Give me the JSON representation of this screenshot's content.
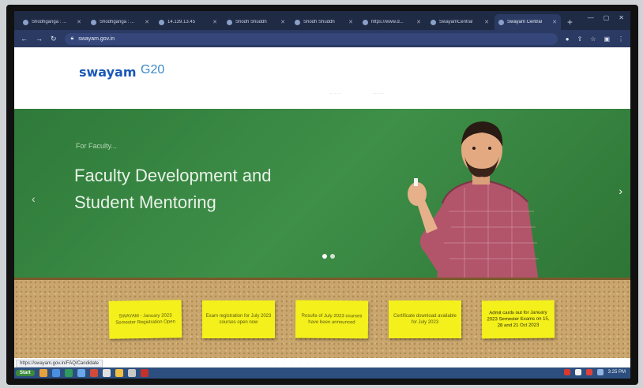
{
  "browser": {
    "tabs": [
      {
        "title": "Shodhganga : ...",
        "active": false
      },
      {
        "title": "Shodhganga : ...",
        "active": false
      },
      {
        "title": "14.139.13.45",
        "active": false
      },
      {
        "title": "Shodh Shuddh",
        "active": false
      },
      {
        "title": "Shodh Shuddh",
        "active": false
      },
      {
        "title": "https://www.d...",
        "active": false
      },
      {
        "title": "SwayamCentral",
        "active": false
      },
      {
        "title": "Swayam Central",
        "active": true
      }
    ],
    "new_tab_label": "+",
    "url": "swayam.gov.in"
  },
  "site": {
    "logo_text": "swayam",
    "g20_text": "G20",
    "nav_items": [
      "· · · · ·",
      "· · · · ·"
    ]
  },
  "hero": {
    "kicker": "For Faculty...",
    "title_line1": "Faculty Development and",
    "title_line2": "Student Mentoring",
    "prev_label": "‹",
    "next_label": "›"
  },
  "notes": [
    {
      "text": "SWAYAM - January 2023 Semester Registration Open"
    },
    {
      "text": "Exam registration for July 2023 courses open now"
    },
    {
      "text": "Results of July 2023 courses have been announced"
    },
    {
      "text": "Certificate download available for July 2023"
    },
    {
      "text": "Admit cards out for January 2023 Semester Exams on 15, 28 and 21 Oct 2023"
    }
  ],
  "page_bottom_label": "· · · · · · · · · · · ·",
  "status_url": "https://swayam.gov.in/FAQ/Candidate",
  "taskbar": {
    "start_label": "Start",
    "clock": "3:25 PM"
  },
  "colors": {
    "hero_green": "#3e8f48",
    "note_yellow": "#f4f01c",
    "brand_blue": "#1a58b8"
  }
}
